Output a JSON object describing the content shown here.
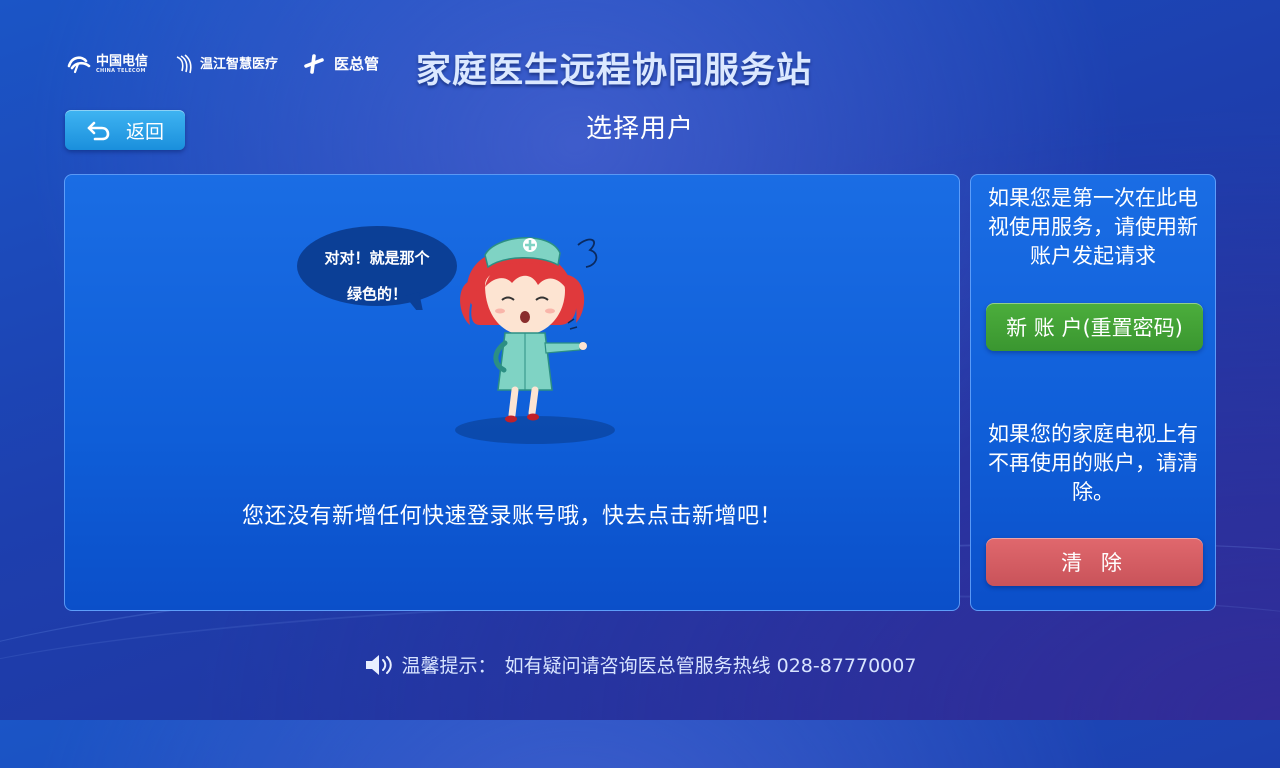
{
  "header": {
    "logos": [
      {
        "name": "中国电信",
        "sub": "CHINA TELECOM"
      },
      {
        "name": "温江智慧医疗"
      },
      {
        "name": "医总管"
      }
    ],
    "app_title": "家庭医生远程协同服务站"
  },
  "nav": {
    "back_label": "返回",
    "page_title": "选择用户"
  },
  "main": {
    "speech_line1": "对对！就是那个",
    "speech_line2": "绿色的！",
    "empty_message": "您还没有新增任何快速登录账号哦，快去点击新增吧！"
  },
  "side": {
    "new_account_hint": "如果您是第一次在此电视使用服务，请使用新账户发起请求",
    "new_account_button": "新 账 户(重置密码)",
    "clear_hint": "如果您的家庭电视上有不再使用的账户，请清除。",
    "clear_button": "清 除"
  },
  "footer": {
    "label": "温馨提示：",
    "text": "如有疑问请咨询医总管服务热线 028-87770007"
  },
  "colors": {
    "accent_green": "#43a337",
    "accent_red": "#d75e64",
    "back_blue": "#2ba2e8",
    "panel_blue": "#1565dd"
  }
}
